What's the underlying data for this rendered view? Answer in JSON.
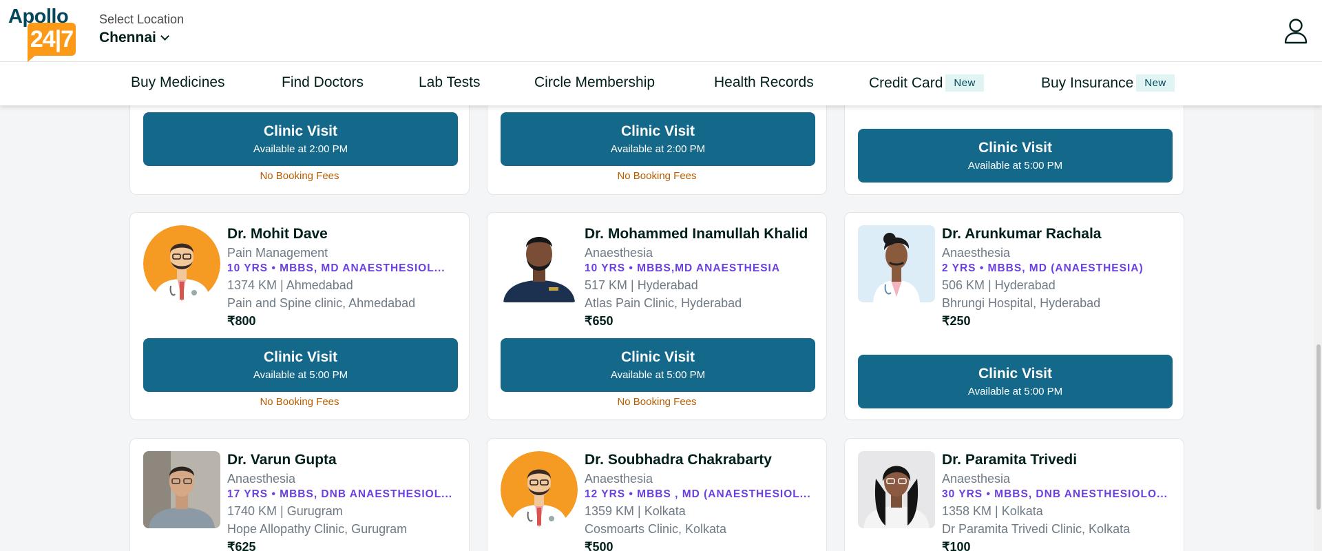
{
  "header": {
    "logo_top": "Apollo",
    "logo_box": "24|7",
    "location_label": "Select Location",
    "location_city": "Chennai"
  },
  "nav": [
    {
      "label": "Buy Medicines"
    },
    {
      "label": "Find Doctors"
    },
    {
      "label": "Lab Tests"
    },
    {
      "label": "Circle Membership"
    },
    {
      "label": "Health Records"
    },
    {
      "label": "Credit Card",
      "badge": "New"
    },
    {
      "label": "Buy Insurance",
      "badge": "New"
    }
  ],
  "top_row": [
    {
      "button_title": "Clinic Visit",
      "button_sub": "Available at 2:00 PM",
      "no_fee": "No Booking Fees"
    },
    {
      "button_title": "Clinic Visit",
      "button_sub": "Available at 2:00 PM",
      "no_fee": "No Booking Fees"
    },
    {
      "button_title": "Clinic Visit",
      "button_sub": "Available at 5:00 PM"
    }
  ],
  "doctors": [
    {
      "name": "Dr. Mohit Dave",
      "specialty": "Pain Management",
      "quals": "10 YRS • MBBS, MD ANAESTHESIOL...",
      "distance": "1374 KM | Ahmedabad",
      "clinic": "Pain and Spine clinic, Ahmedabad",
      "fee": "₹800",
      "button_title": "Clinic Visit",
      "button_sub": "Available at 5:00 PM",
      "no_fee": "No Booking Fees"
    },
    {
      "name": "Dr. Mohammed Inamullah Khalid",
      "specialty": "Anaesthesia",
      "quals": "10 YRS • MBBS,MD ANAESTHESIA",
      "distance": "517 KM | Hyderabad",
      "clinic": "Atlas Pain Clinic, Hyderabad",
      "fee": "₹650",
      "button_title": "Clinic Visit",
      "button_sub": "Available at 5:00 PM",
      "no_fee": "No Booking Fees"
    },
    {
      "name": "Dr. Arunkumar Rachala",
      "specialty": "Anaesthesia",
      "quals": "2 YRS • MBBS, MD (ANAESTHESIA)",
      "distance": "506 KM | Hyderabad",
      "clinic": "Bhrungi Hospital, Hyderabad",
      "fee": "₹250",
      "button_title": "Clinic Visit",
      "button_sub": "Available at 5:00 PM"
    },
    {
      "name": "Dr. Varun Gupta",
      "specialty": "Anaesthesia",
      "quals": "17 YRS • MBBS, DNB ANAESTHESIOL...",
      "distance": "1740 KM | Gurugram",
      "clinic": "Hope Allopathy Clinic, Gurugram",
      "fee": "₹625"
    },
    {
      "name": "Dr. Soubhadra Chakrabarty",
      "specialty": "Anaesthesia",
      "quals": "12 YRS • MBBS , MD (ANAESTHESIOL...",
      "distance": "1359 KM | Kolkata",
      "clinic": "Cosmoarts Clinic, Kolkata",
      "fee": "₹500"
    },
    {
      "name": "Dr. Paramita Trivedi",
      "specialty": "Anaesthesia",
      "quals": "30 YRS • MBBS, DNB ANESTHESIOLO...",
      "distance": "1358 KM | Kolkata",
      "clinic": "Dr Paramita Trivedi Clinic, Kolkata",
      "fee": "₹100"
    }
  ],
  "colors": {
    "brand_dark": "#02475b",
    "brand_orange": "#fc9916",
    "button": "#14698a",
    "quals": "#6b3fe0",
    "no_fee": "#b85c00"
  }
}
